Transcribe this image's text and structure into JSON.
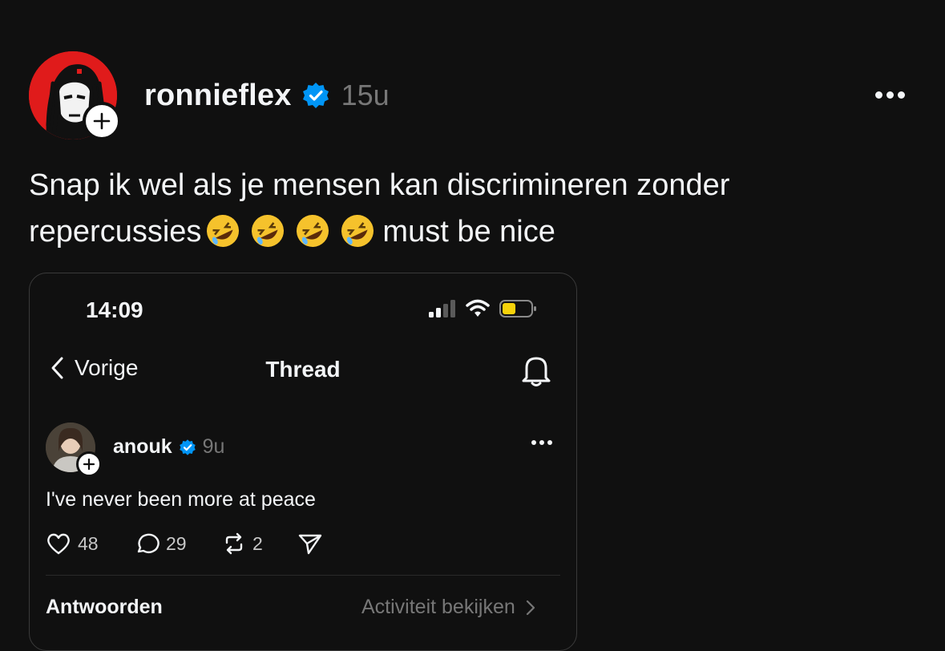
{
  "post": {
    "author": "ronnieflex",
    "time": "15u",
    "text_line1": "Snap ik wel als je mensen kan discrimineren zonder",
    "text_line2_start": "repercussies",
    "emojis": [
      "🤣",
      "🤣",
      "🤣",
      "🤣"
    ],
    "text_line2_end": "must be nice",
    "follow_symbol": "+",
    "accent_color": "#0095f6"
  },
  "embedded": {
    "status_time": "14:09",
    "nav": {
      "back_label": "Vorige",
      "title": "Thread"
    },
    "thread_post": {
      "author": "anouk",
      "time": "9u",
      "text": "I've never been more at peace",
      "likes": "48",
      "replies": "29",
      "reposts": "2"
    },
    "footer": {
      "replies_heading": "Antwoorden",
      "activity_link": "Activiteit bekijken"
    },
    "icons": {
      "signal": "signal-icon",
      "wifi": "wifi-icon",
      "battery": "battery-icon",
      "back": "chevron-left-icon",
      "bell": "bell-icon",
      "like": "heart-icon",
      "reply": "comment-icon",
      "repost": "repost-icon",
      "share": "send-icon"
    }
  }
}
